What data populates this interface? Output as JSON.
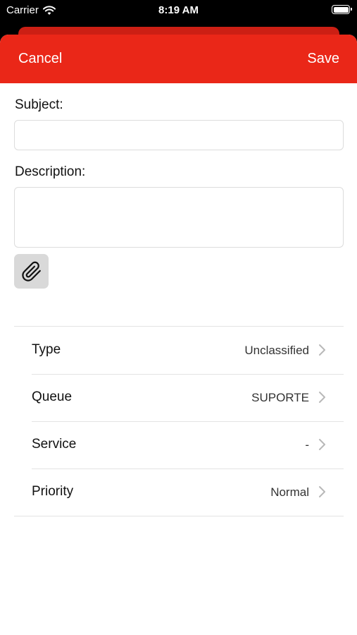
{
  "status_bar": {
    "carrier": "Carrier",
    "time": "8:19 AM"
  },
  "nav": {
    "cancel_label": "Cancel",
    "save_label": "Save"
  },
  "form": {
    "subject_label": "Subject:",
    "subject_value": "",
    "description_label": "Description:",
    "description_value": ""
  },
  "attributes": [
    {
      "label": "Type",
      "value": "Unclassified"
    },
    {
      "label": "Queue",
      "value": "SUPORTE"
    },
    {
      "label": "Service",
      "value": "-"
    },
    {
      "label": "Priority",
      "value": "Normal"
    }
  ],
  "icons": {
    "attach": "paperclip-icon",
    "row_chevron": "chevron-right-icon",
    "wifi": "wifi-icon",
    "battery": "battery-icon"
  },
  "colors": {
    "accent": "#ea2718",
    "accent_dark": "#cc1f14",
    "attach_button_bg": "#d9d9d9"
  }
}
